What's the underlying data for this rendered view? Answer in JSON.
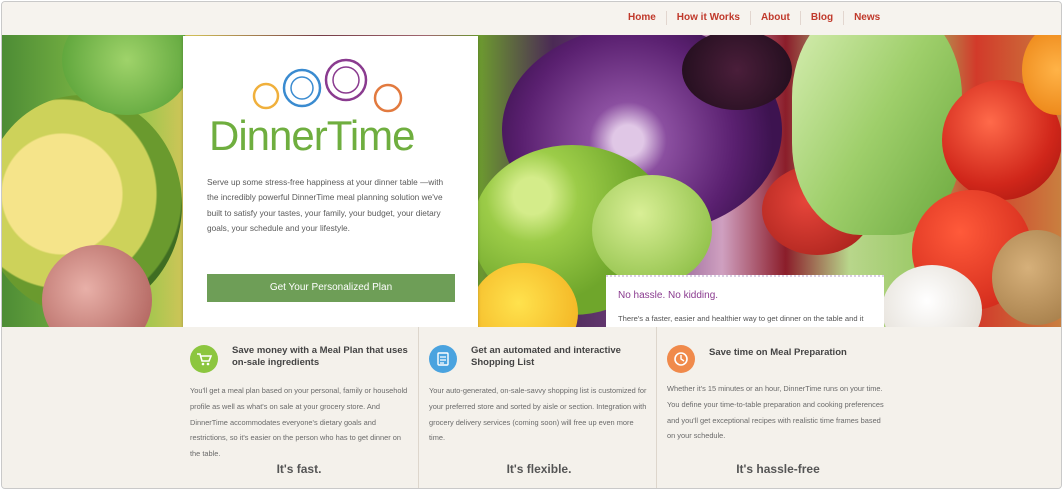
{
  "nav": {
    "items": [
      "Home",
      "How it Works",
      "About",
      "Blog",
      "News"
    ]
  },
  "brand": {
    "name": "DinnerTime",
    "color_green": "#6fae3f",
    "ring_colors": [
      "#f0b03c",
      "#3a8bd0",
      "#8a3b8f",
      "#f0b03c",
      "#e27a3f"
    ]
  },
  "hero": {
    "intro": "Serve up some stress-free happiness at your dinner table —with the incredibly powerful DinnerTime meal planning solution we've built to satisfy your tastes, your family, your budget, your dietary goals, your schedule and your lifestyle.",
    "cta_label": "Get Your Personalized Plan",
    "note_title": "No hassle. No kidding.",
    "note_body": "There's a faster, easier and healthier way to get dinner on the table and it starts here. At DinnerTime."
  },
  "features": [
    {
      "icon": "cart-icon",
      "icon_color": "#8cc63f",
      "title": "Save money with a Meal Plan that uses on-sale ingredients",
      "body": "You'll get a meal plan based on your personal, family or household profile as well as what's on sale at your grocery store. And DinnerTime accommodates everyone's dietary goals and restrictions, so it's easier on the person who has to get dinner on the table.",
      "tag": "It's fast."
    },
    {
      "icon": "list-icon",
      "icon_color": "#4aa3df",
      "title": "Get an automated and interactive Shopping List",
      "body": "Your auto-generated, on-sale-savvy shopping list is customized for your preferred store and sorted by aisle or section. Integration with grocery delivery services (coming soon) will free up even more time.",
      "tag": "It's flexible."
    },
    {
      "icon": "clock-icon",
      "icon_color": "#f08a4b",
      "title": "Save time on Meal Preparation",
      "body": "Whether it's 15 minutes or an hour, DinnerTime runs on your time. You define your time-to-table preparation and cooking preferences and you'll get exceptional recipes with realistic time frames based on your schedule.",
      "tag": "It's hassle-free"
    }
  ]
}
